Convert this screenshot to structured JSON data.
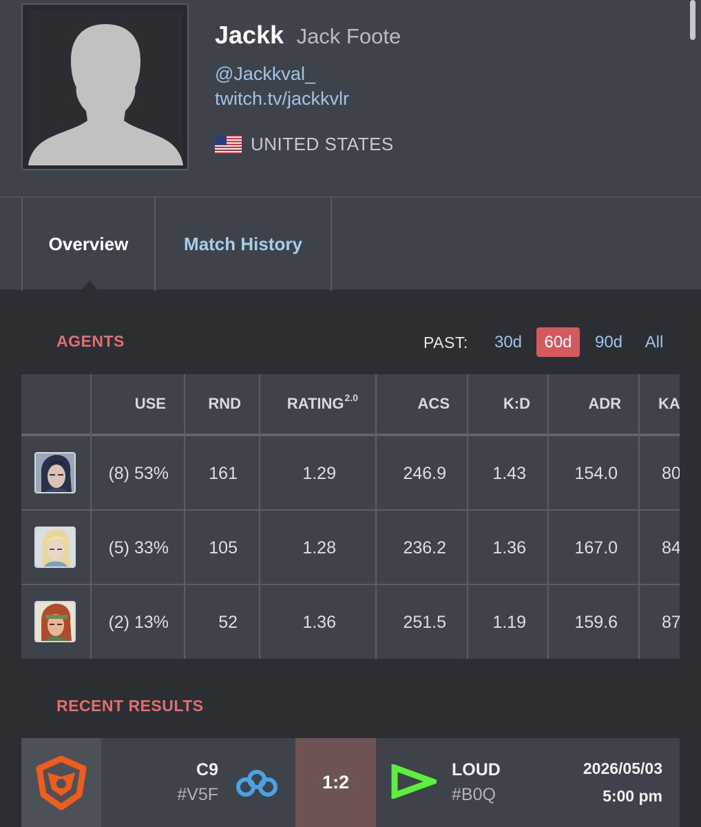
{
  "player": {
    "alias": "Jackk",
    "real_name": "Jack Foote",
    "twitter": "@Jackkval_",
    "twitch": "twitch.tv/jackkvlr",
    "country": "UNITED STATES",
    "flag_icon": "us-flag-icon"
  },
  "tabs": [
    {
      "label": "Overview",
      "active": true
    },
    {
      "label": "Match History",
      "active": false
    }
  ],
  "agents": {
    "title": "AGENTS",
    "past_label": "PAST:",
    "periods": [
      {
        "label": "30d",
        "active": false
      },
      {
        "label": "60d",
        "active": true
      },
      {
        "label": "90d",
        "active": false
      },
      {
        "label": "All",
        "active": false
      }
    ],
    "headers": {
      "use": "USE",
      "rnd": "RND",
      "rating": "RATING",
      "rating_sup": "2.0",
      "acs": "ACS",
      "kd": "K:D",
      "adr": "ADR",
      "ka": "KA"
    },
    "rows": [
      {
        "agent_icon": "agent-portrait-dark-hair-icon",
        "use": "(8) 53%",
        "rnd": "161",
        "rating": "1.29",
        "acs": "246.9",
        "kd": "1.43",
        "adr": "154.0",
        "ka": "80"
      },
      {
        "agent_icon": "agent-portrait-blonde-hair-icon",
        "use": "(5) 33%",
        "rnd": "105",
        "rating": "1.28",
        "acs": "236.2",
        "kd": "1.36",
        "adr": "167.0",
        "ka": "84"
      },
      {
        "agent_icon": "agent-portrait-red-hair-headband-icon",
        "use": "(2) 13%",
        "rnd": "52",
        "rating": "1.36",
        "acs": "251.5",
        "kd": "1.19",
        "adr": "159.6",
        "ka": "87"
      }
    ]
  },
  "recent_results": {
    "title": "RECENT RESULTS",
    "matches": [
      {
        "event_icon": "vct-event-logo-icon",
        "team1": {
          "name": "C9",
          "tag": "#V5F",
          "logo": "cloud9-logo-icon"
        },
        "score": "1:2",
        "team2": {
          "name": "LOUD",
          "tag": "#B0Q",
          "logo": "loud-logo-icon"
        },
        "date": "2026/05/03",
        "time": "5:00 pm"
      }
    ]
  },
  "colors": {
    "accent_red": "#e16f70",
    "link_blue": "#9fc4e6",
    "active_period": "#d45a5f",
    "loss_score_bg": "#6e5354",
    "loud_green": "#5af03c",
    "cloud9_blue": "#4aa3e2",
    "event_orange": "#ef5d1d"
  }
}
